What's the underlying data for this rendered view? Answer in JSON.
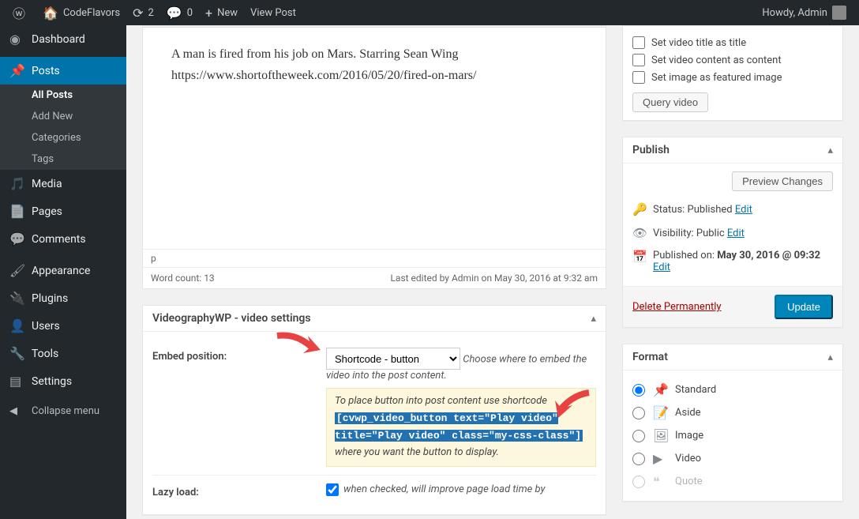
{
  "adminbar": {
    "site": "CodeFlavors",
    "updates": "2",
    "comments": "0",
    "new": "New",
    "view_post": "View Post",
    "howdy": "Howdy, Admin"
  },
  "sidebar": {
    "dashboard": "Dashboard",
    "posts": "Posts",
    "posts_sub": {
      "all": "All Posts",
      "add": "Add New",
      "categories": "Categories",
      "tags": "Tags"
    },
    "media": "Media",
    "pages": "Pages",
    "comments": "Comments",
    "appearance": "Appearance",
    "plugins": "Plugins",
    "users": "Users",
    "tools": "Tools",
    "settings": "Settings",
    "collapse": "Collapse menu"
  },
  "editor": {
    "body_line1": "A man is fired from his job on Mars. Starring Sean Wing",
    "body_line2": "https://www.shortoftheweek.com/2016/05/20/fired-on-mars/",
    "path": "p",
    "wordcount_label": "Word count: ",
    "wordcount": "13",
    "last_edited": "Last edited by Admin on May 30, 2016 at 9:32 am"
  },
  "videobox": {
    "title": "VideographyWP - video settings",
    "embed_label": "Embed position:",
    "embed_value": "Shortcode - button",
    "embed_desc": "Choose where to embed the video into the post content.",
    "hint_pre": "To place button into post content use shortcode",
    "hint_code": "[cvwp_video_button text=\"Play video\" title=\"Play video\" class=\"my-css-class\"]",
    "hint_post": "where you want the button to display.",
    "lazy_label": "Lazy load:",
    "lazy_desc": "when checked, will improve page load time by"
  },
  "video_options": {
    "title": "Set video title as title",
    "content": "Set video content as content",
    "image": "Set image as featured image",
    "query": "Query video"
  },
  "publish": {
    "title": "Publish",
    "preview": "Preview Changes",
    "status_label": "Status: ",
    "status_value": "Published",
    "vis_label": "Visibility: ",
    "vis_value": "Public",
    "pub_label": "Published on: ",
    "pub_value": "May 30, 2016 @ 09:32",
    "edit": "Edit",
    "delete": "Delete Permanently",
    "update": "Update"
  },
  "format": {
    "title": "Format",
    "standard": "Standard",
    "aside": "Aside",
    "image": "Image",
    "video": "Video",
    "quote": "Quote"
  }
}
